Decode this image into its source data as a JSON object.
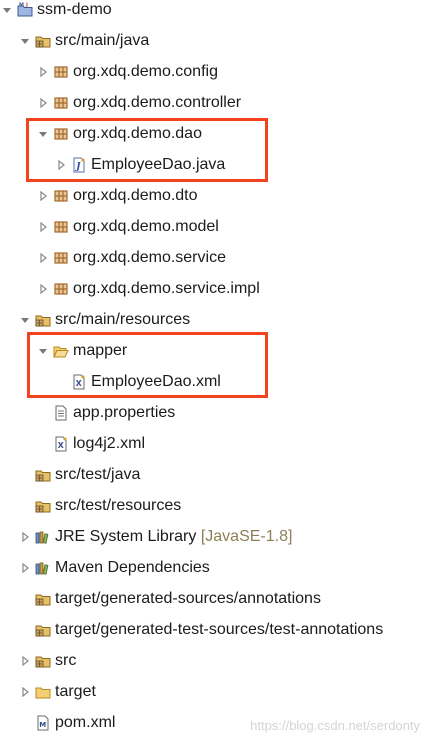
{
  "tree": {
    "project": "ssm-demo",
    "src_main_java": "src/main/java",
    "packages": [
      "org.xdq.demo.config",
      "org.xdq.demo.controller",
      "org.xdq.demo.dao",
      "org.xdq.demo.dto",
      "org.xdq.demo.model",
      "org.xdq.demo.service",
      "org.xdq.demo.service.impl"
    ],
    "dao_file": "EmployeeDao.java",
    "src_main_resources": "src/main/resources",
    "mapper_folder": "mapper",
    "mapper_file": "EmployeeDao.xml",
    "app_properties": "app.properties",
    "log4j2": "log4j2.xml",
    "src_test_java": "src/test/java",
    "src_test_resources": "src/test/resources",
    "jre_library": "JRE System Library",
    "jre_version": "[JavaSE-1.8]",
    "maven_deps": "Maven Dependencies",
    "gen_sources": "target/generated-sources/annotations",
    "gen_test_sources": "target/generated-test-sources/test-annotations",
    "src": "src",
    "target": "target",
    "pom": "pom.xml"
  },
  "watermark": "https://blog.csdn.net/serdonty",
  "colors": {
    "highlight": "#f2431e",
    "package": "#a46a2b",
    "folder": "#e1b44b"
  }
}
